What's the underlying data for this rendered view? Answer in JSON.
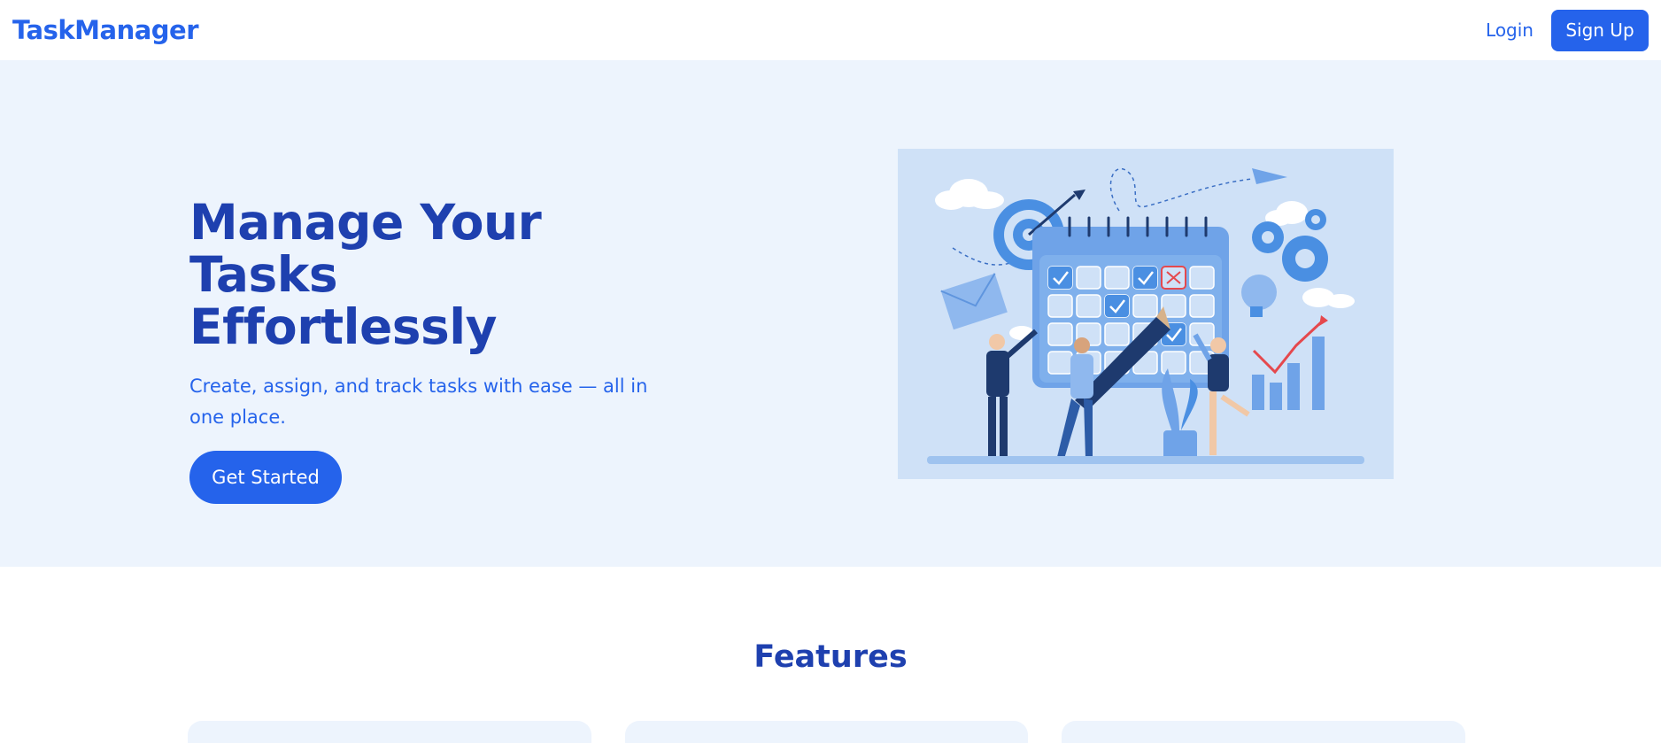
{
  "header": {
    "brand": "TaskManager",
    "login_label": "Login",
    "signup_label": "Sign Up"
  },
  "hero": {
    "title_line1": "Manage Your Tasks",
    "title_line2": "Effortlessly",
    "subtitle": "Create, assign, and track tasks with ease — all in one place.",
    "cta_label": "Get Started"
  },
  "features": {
    "title": "Features",
    "cards": [
      {},
      {},
      {}
    ]
  },
  "colors": {
    "primary": "#2563eb",
    "heading": "#1e40af",
    "hero_bg": "#edf4fd",
    "illustration_bg": "#cfe1f7",
    "accent_red": "#e5484d"
  }
}
